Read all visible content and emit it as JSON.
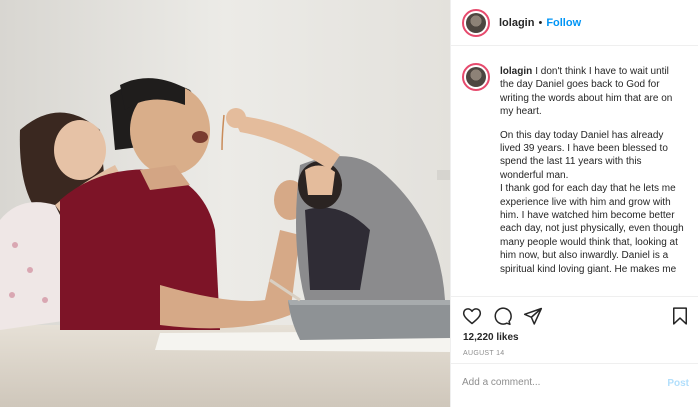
{
  "post": {
    "username": "lolagin",
    "separator": "•",
    "follow_label": "Follow",
    "caption_user": "lolagin",
    "caption_lead": "I don't think I have to wait until the day Daniel goes back to God for writing the words about him that are on my heart.",
    "caption_p2": "On this day today Daniel has already lived 39 years. I have been blessed to spend the last 11 years with this wonderful man.",
    "caption_p3": "I thank god for each day that he lets me experience live with him and grow with him. I have watched him become better each day, not just physically, even though many people would think that, looking at him now, but also inwardly. Daniel is a spiritual kind loving giant. He makes me",
    "likes": "12,220 likes",
    "date": "AUGUST 14"
  },
  "comment": {
    "placeholder": "Add a comment...",
    "post_label": "Post"
  },
  "icons": {
    "like": "heart-icon",
    "comment": "comment-icon",
    "share": "share-icon",
    "save": "bookmark-icon"
  },
  "colors": {
    "follow": "#0095f6",
    "post_disabled": "#b2dffc",
    "avatar_ring": "#e64a6d"
  }
}
